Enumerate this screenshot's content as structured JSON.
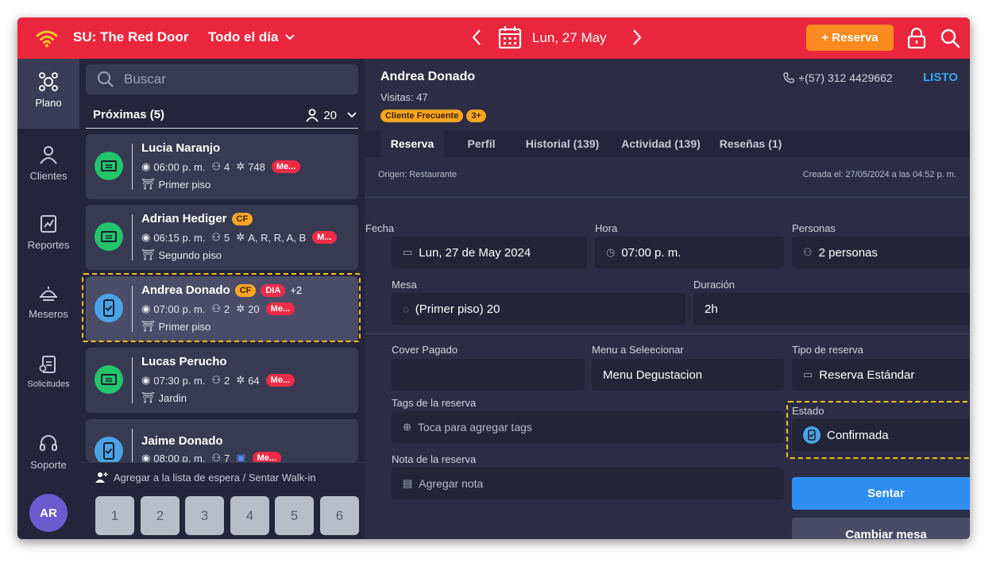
{
  "topbar": {
    "venue": "SU: The Red Door",
    "period": "Todo el día",
    "date": "Lun, 27 May",
    "new_reservation": "+ Reserva",
    "accent_color": "#e9263d"
  },
  "nav": {
    "items": [
      {
        "label": "Plano",
        "icon": "floor-plan-icon",
        "active": true
      },
      {
        "label": "Clientes",
        "icon": "user-icon"
      },
      {
        "label": "Reportes",
        "icon": "chart-icon"
      },
      {
        "label": "Meseros",
        "icon": "waiter-icon"
      },
      {
        "label": "Solicitudes",
        "icon": "requests-icon"
      },
      {
        "label": "Soporte",
        "icon": "headset-icon"
      }
    ],
    "avatar": "AR"
  },
  "list": {
    "search_placeholder": "Buscar",
    "header": "Próximas (5)",
    "guest_count": "20",
    "reservations": [
      {
        "name": "Lucia Naranjo",
        "time": "06:00 p. m.",
        "people": "4",
        "table": "748",
        "tag": "Me...",
        "area": "Primer piso"
      },
      {
        "name": "Adrian Hediger",
        "badge": "CF",
        "time": "06:15 p. m.",
        "people": "5",
        "table": "A, R, R, A, B",
        "tag": "M...",
        "area": "Segundo piso"
      },
      {
        "name": "Andrea Donado",
        "badge": "CF",
        "badge2": "DIA",
        "extra": "+2",
        "time": "07:00 p. m.",
        "people": "2",
        "table": "20",
        "tag": "Me...",
        "area": "Primer piso"
      },
      {
        "name": "Lucas Perucho",
        "time": "07:30 p. m.",
        "people": "2",
        "table": "64",
        "tag": "Me...",
        "area": "Jardin"
      },
      {
        "name": "Jaime Donado",
        "time": "08:00 p. m.",
        "people": "7",
        "tag": "Me..."
      }
    ],
    "waitlist_label": "Agregar a la lista de espera / Sentar Walk-in",
    "party_sizes": [
      "1",
      "2",
      "3",
      "4",
      "5",
      "6"
    ]
  },
  "detail": {
    "name": "Andrea Donado",
    "visits": "Visitas: 47",
    "badge_frequent": "Cliente Frecuente",
    "badge_count": "3+",
    "phone": "+(57) 312 4429662",
    "status_link": "LISTO",
    "tabs": [
      "Reserva",
      "Perfil",
      "Historial (139)",
      "Actividad (139)",
      "Reseñas (1)"
    ],
    "origin": "Origen: Restaurante",
    "created": "Creada el: 27/05/2024 a las 04:52 p. m.",
    "labels": {
      "fecha": "Fecha",
      "hora": "Hora",
      "personas": "Personas",
      "mesa": "Mesa",
      "duracion": "Duración",
      "cover": "Cover Pagado",
      "menu": "Menu a Seleecionar",
      "tipo": "Tipo de reserva",
      "tags": "Tags de la reserva",
      "estado": "Estado",
      "nota": "Nota de la reserva"
    },
    "values": {
      "fecha": "Lun, 27 de May 2024",
      "hora": "07:00 p. m.",
      "personas": "2 personas",
      "mesa": "(Primer piso) 20",
      "duracion": "2h",
      "cover": "",
      "menu": "Menu Degustacion",
      "tipo": "Reserva Estándar",
      "tags_placeholder": "Toca para agregar tags",
      "estado": "Confirmada",
      "nota_placeholder": "Agregar nota"
    },
    "buttons": {
      "sentar": "Sentar",
      "cambiar_mesa": "Cambiar mesa"
    }
  }
}
